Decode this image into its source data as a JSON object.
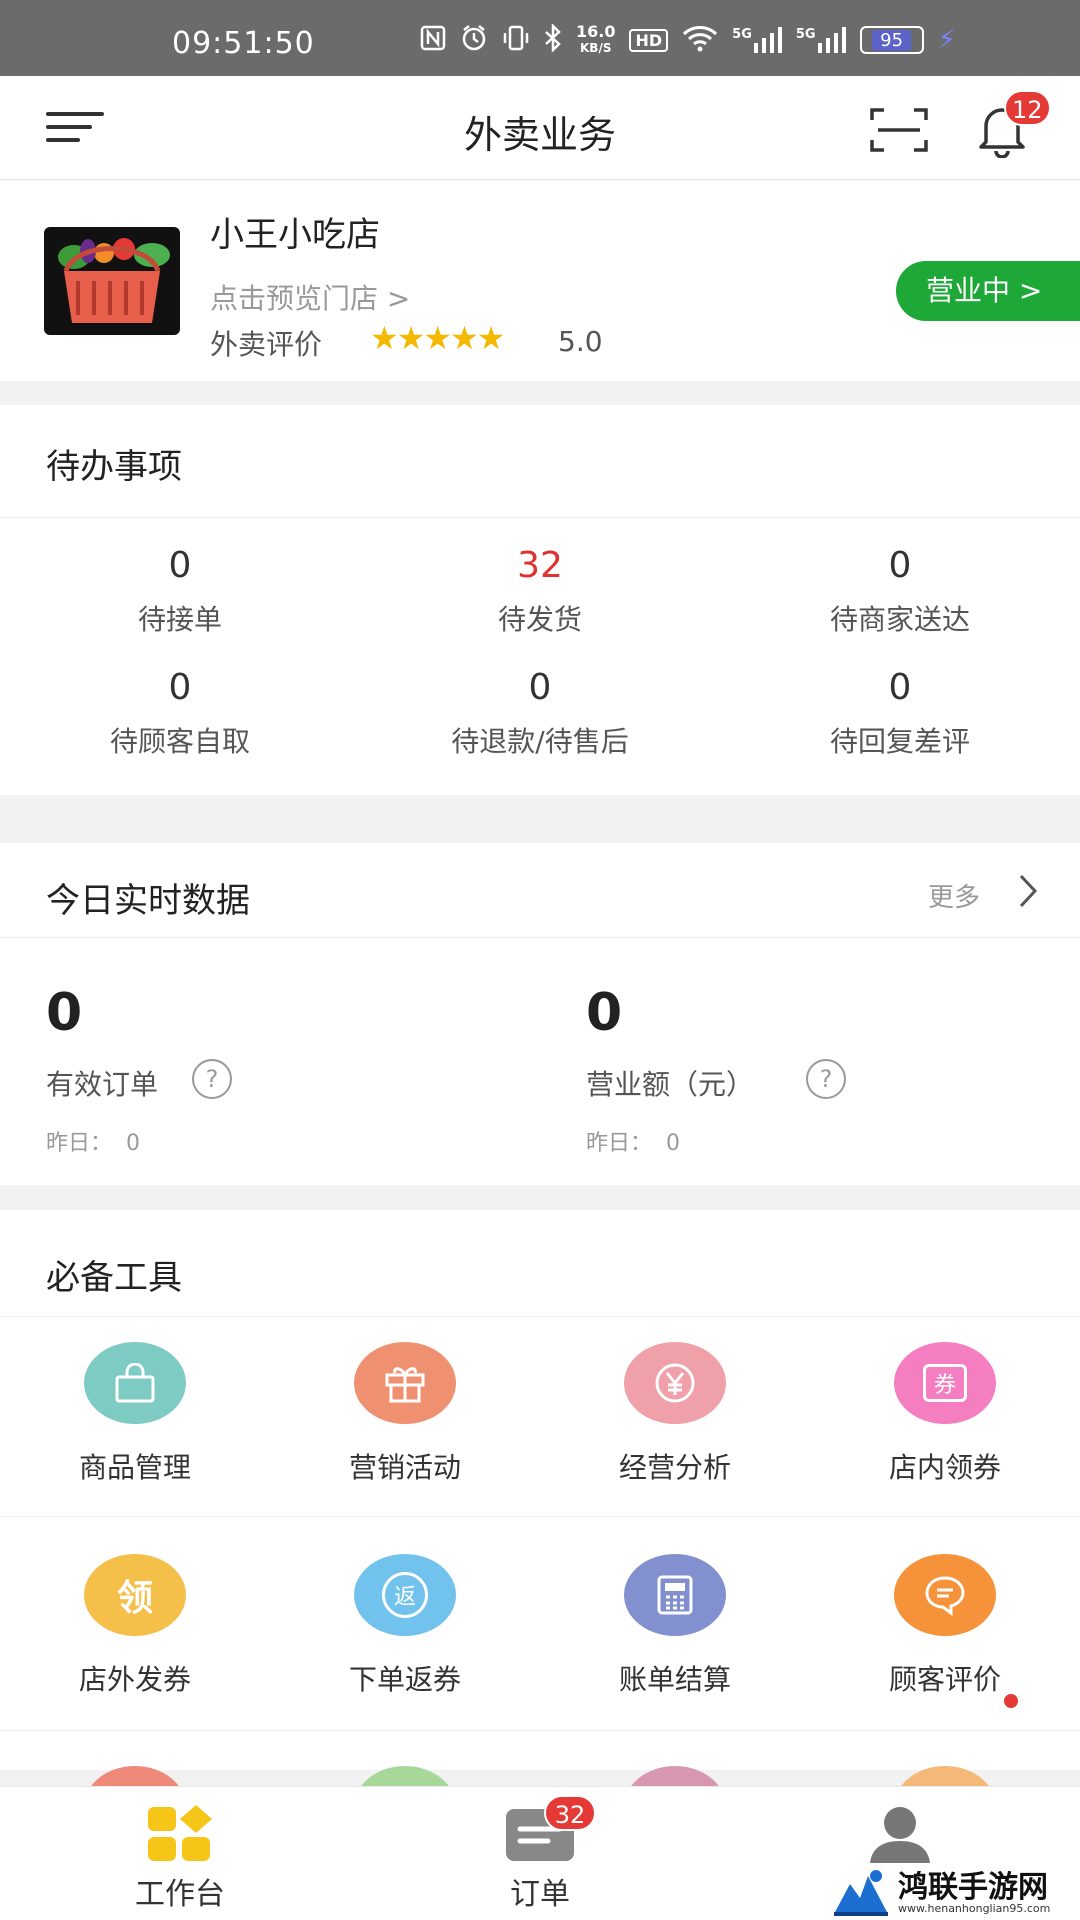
{
  "status_bar": {
    "time": "09:51:50",
    "net_speed_value": "16.0",
    "net_speed_unit": "KB/S",
    "hd_label": "HD",
    "signal1": "5G",
    "signal2": "5G",
    "battery": "95",
    "icons": [
      "nfc-icon",
      "alarm-icon",
      "vibrate-icon",
      "bluetooth-icon",
      "wifi-icon",
      "signal-icon",
      "battery-icon",
      "charging-icon"
    ]
  },
  "header": {
    "title": "外卖业务",
    "notification_count": "12"
  },
  "store": {
    "name": "小王小吃店",
    "preview_link": "点击预览门店 >",
    "rating_label": "外卖评价",
    "stars": "★★★★★",
    "rating": 5.0,
    "rating_text": "5.0",
    "status_button": "营业中 >"
  },
  "todo": {
    "title": "待办事项",
    "items": [
      {
        "count": "0",
        "label": "待接单"
      },
      {
        "count": "32",
        "label": "待发货"
      },
      {
        "count": "0",
        "label": "待商家送达"
      },
      {
        "count": "0",
        "label": "待顾客自取"
      },
      {
        "count": "0",
        "label": "待退款/待售后"
      },
      {
        "count": "0",
        "label": "待回复差评"
      }
    ],
    "highlight_color": "#e03030"
  },
  "realtime": {
    "title": "今日实时数据",
    "more": "更多",
    "metrics": [
      {
        "value": "0",
        "label": "有效订单",
        "yesterday_label": "昨日：",
        "yesterday_value": "0"
      },
      {
        "value": "0",
        "label": "营业额（元）",
        "yesterday_label": "昨日：",
        "yesterday_value": "0"
      }
    ]
  },
  "tools": {
    "title": "必备工具",
    "items": [
      {
        "label": "商品管理",
        "icon": "shopping-bag-icon",
        "color": "#7ecbc4"
      },
      {
        "label": "营销活动",
        "icon": "gift-icon",
        "color": "#ef9170"
      },
      {
        "label": "经营分析",
        "icon": "yen-icon",
        "color": "#f0a0a8"
      },
      {
        "label": "店内领券",
        "icon": "coupon-icon",
        "color": "#f57ec1",
        "glyph": "券"
      },
      {
        "label": "店外发券",
        "icon": "collect-coupon-icon",
        "color": "#f4c04a",
        "glyph": "领"
      },
      {
        "label": "下单返券",
        "icon": "return-coupon-icon",
        "color": "#72c2ee",
        "glyph": "返"
      },
      {
        "label": "账单结算",
        "icon": "calculator-icon",
        "color": "#8290d0"
      },
      {
        "label": "顾客评价",
        "icon": "chat-bubble-icon",
        "color": "#f5923a",
        "has_dot": true
      }
    ],
    "partial_row_colors": [
      "#ef8a7a",
      "#a7d89a",
      "#d897b0",
      "#f5b878"
    ]
  },
  "bottom_nav": {
    "items": [
      {
        "label": "工作台",
        "icon": "dashboard-icon",
        "color": "#f5c518"
      },
      {
        "label": "订单",
        "icon": "orders-icon",
        "color": "#888888",
        "badge": "32"
      },
      {
        "label": "",
        "icon": "profile-icon",
        "color": "#777777"
      }
    ]
  },
  "watermark": {
    "title": "鸿联手游网",
    "url": "www.henanhonglian95.com"
  },
  "colors": {
    "accent_green": "#1ea838",
    "badge_red": "#e53935",
    "star_yellow": "#f5b800"
  }
}
